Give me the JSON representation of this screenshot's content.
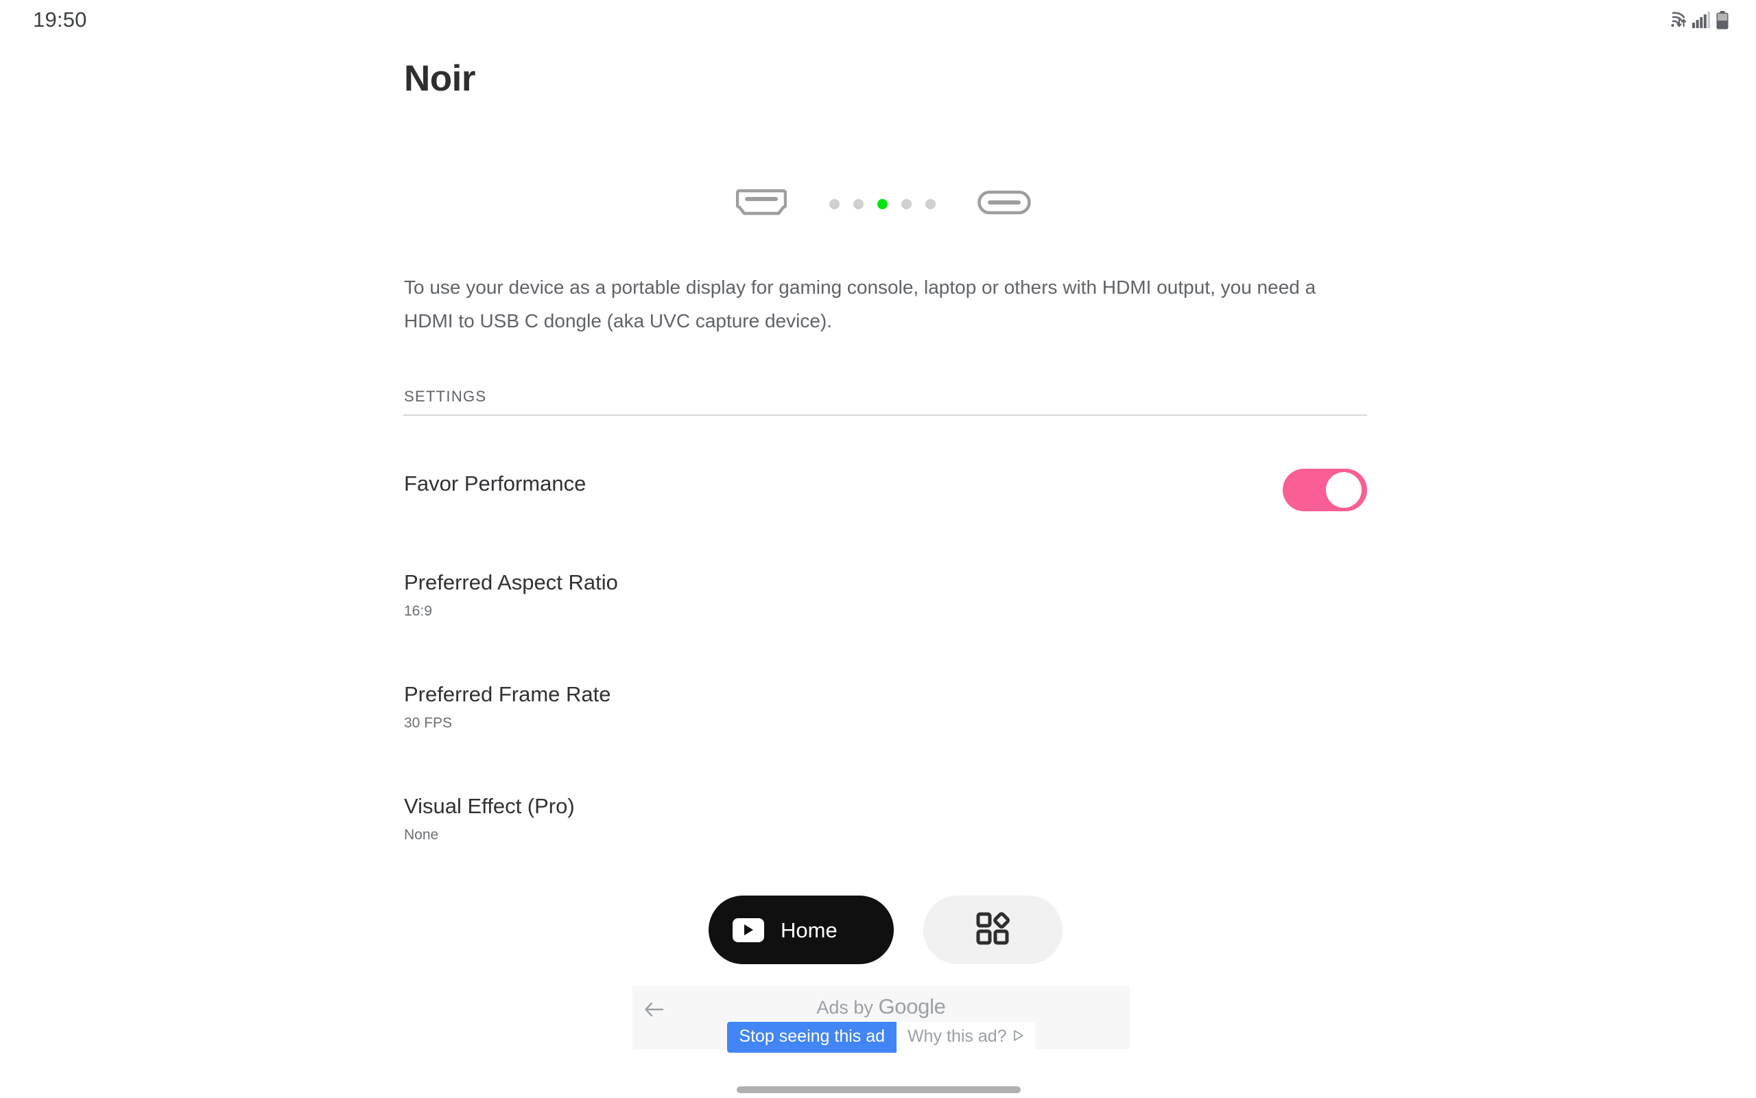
{
  "status_bar": {
    "clock": "19:50",
    "icons": [
      "wifi-icon",
      "cellular-signal-icon",
      "battery-icon"
    ]
  },
  "header": {
    "title": "Noir"
  },
  "illustration": {
    "left_connector_icon": "hdmi-port-icon",
    "right_connector_icon": "usb-c-port-icon",
    "dot_count": 5,
    "active_dot_index": 2,
    "active_dot_color": "#00e510",
    "inactive_dot_color": "#cfcfcf"
  },
  "description": {
    "text": "To use your device as a portable display for gaming console, laptop or others with HDMI output, you need a HDMI to USB C dongle (aka UVC capture device)."
  },
  "settings": {
    "section_label": "SETTINGS",
    "rows": [
      {
        "title": "Favor Performance",
        "value": "",
        "control": "toggle",
        "toggle_on": true,
        "toggle_color": "#fb5e94"
      },
      {
        "title": "Preferred Aspect Ratio",
        "value": "16:9",
        "control": "value"
      },
      {
        "title": "Preferred Frame Rate",
        "value": "30 FPS",
        "control": "value"
      },
      {
        "title": "Visual Effect (Pro)",
        "value": "None",
        "control": "value"
      }
    ]
  },
  "actions": {
    "home_label": "Home",
    "home_icon": "play-button-icon",
    "home_bg_color": "#101010",
    "apps_icon": "apps-grid-icon",
    "apps_bg_color": "#f1f1f1"
  },
  "ad_overlay": {
    "back_icon": "back-arrow-icon",
    "byline_prefix": "Ads by ",
    "byline_brand": "Google",
    "stop_label": "Stop seeing this ad",
    "stop_color": "#4285f4",
    "why_label": "Why this ad?",
    "why_icon": "ad-choices-icon"
  },
  "system": {
    "home_indicator": "home-indicator-bar"
  }
}
